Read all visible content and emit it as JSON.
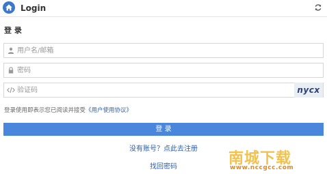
{
  "header": {
    "title": "Login",
    "home_icon": "home-icon",
    "refresh_icon": "refresh-icon"
  },
  "form": {
    "section_title": "登 录",
    "username": {
      "placeholder": "用户名/邮箱",
      "value": ""
    },
    "password": {
      "placeholder": "密码",
      "value": ""
    },
    "captcha": {
      "placeholder": "验证码",
      "value": "",
      "image_text": "nycx"
    },
    "agreement_prefix": "登录使用即表示您已阅读并接受",
    "agreement_link": "《用户使用协议》",
    "login_label": "登 录",
    "register_link": "没有账号？点此去注册",
    "forgot_link": "找回密码"
  },
  "watermark": {
    "title": "南城下载",
    "url": "www.nccgcc.com"
  },
  "colors": {
    "accent": "#4a87dc",
    "home": "#3c78c9",
    "link": "#2f5da8",
    "watermark_main": "#f2c14e",
    "watermark_url": "#e08a22"
  }
}
